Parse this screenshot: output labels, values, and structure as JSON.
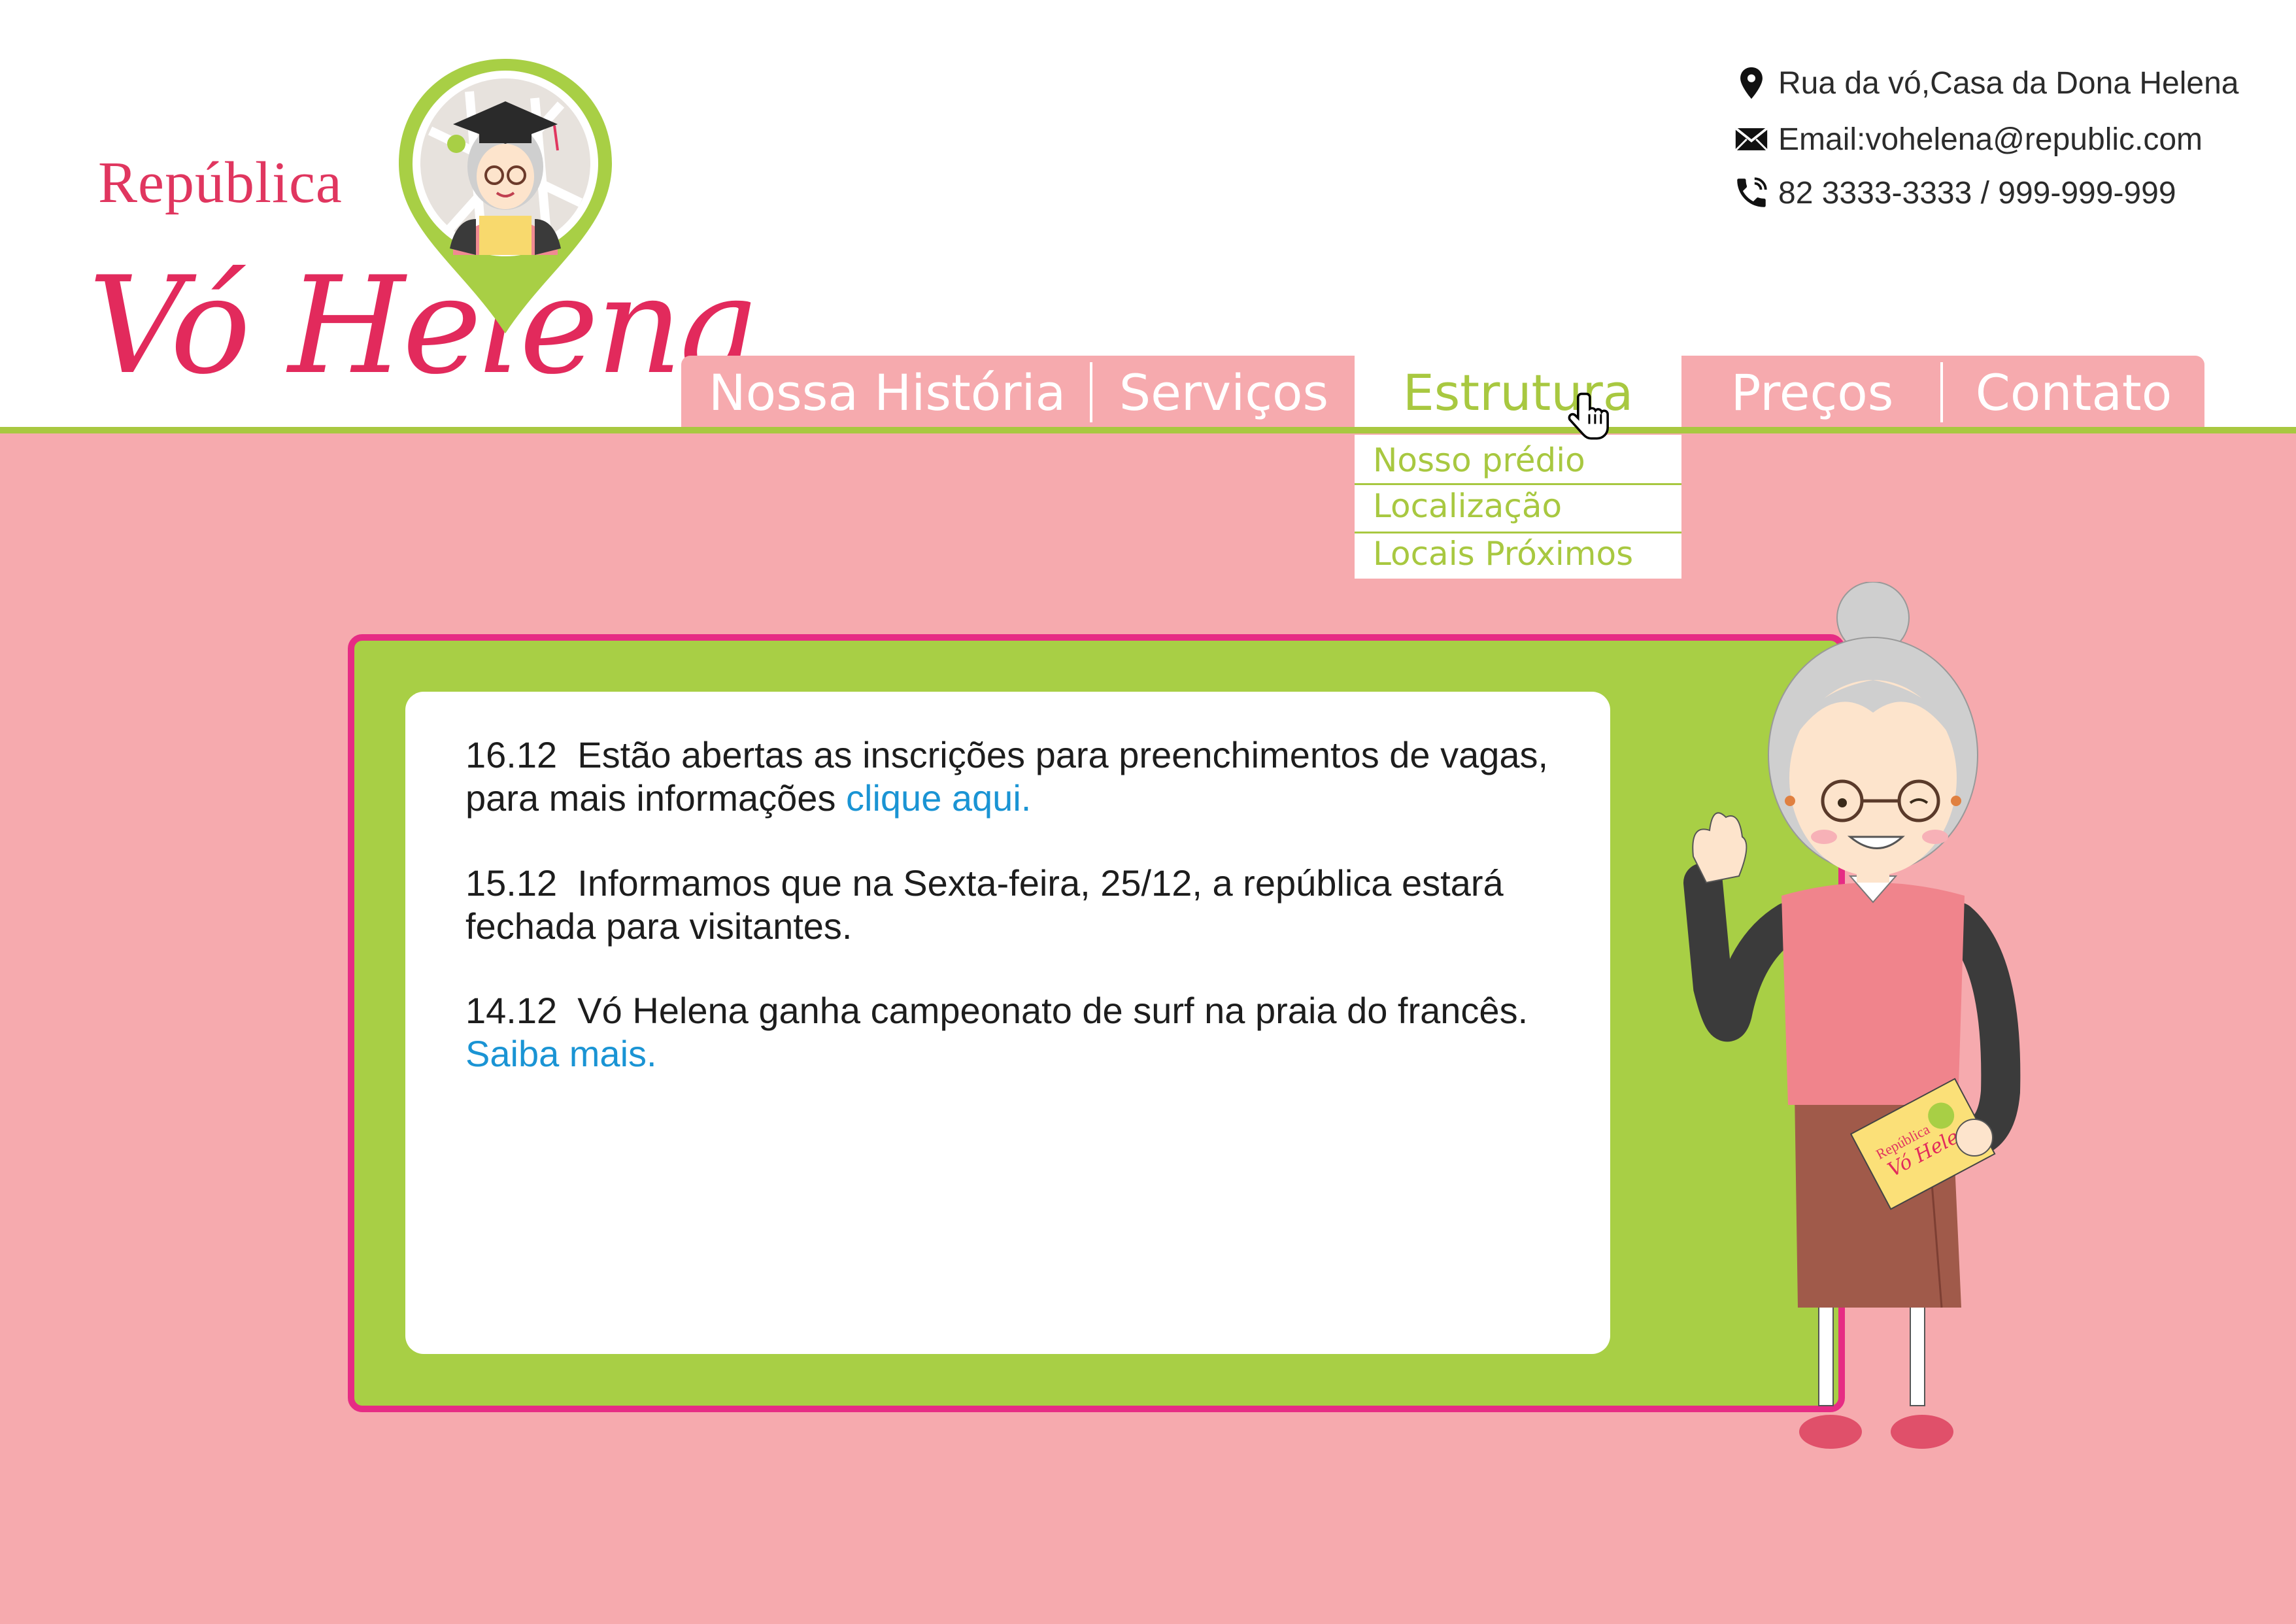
{
  "brand": {
    "line1": "República",
    "line2": "Vó Helena"
  },
  "contact": {
    "address": "Rua da vó,Casa da Dona Helena",
    "email": "Email:vohelena@republic.com",
    "phone": "82 3333-3333 / 999-999-999"
  },
  "nav": {
    "items": [
      {
        "label": "Nossa História"
      },
      {
        "label": "Serviços"
      },
      {
        "label": "Estrutura",
        "active": true
      },
      {
        "label": "Preços"
      },
      {
        "label": "Contato"
      }
    ],
    "dropdown": [
      {
        "label": "Nosso prédio"
      },
      {
        "label": "Localização"
      },
      {
        "label": "Locais Próximos"
      }
    ]
  },
  "news": [
    {
      "date": "16.12",
      "text": "Estão abertas as inscrições para preenchimentos de vagas, para mais informações ",
      "link": "clique aqui."
    },
    {
      "date": "15.12",
      "text": "Informamos que na Sexta-feira, 25/12, a república estará fechada para visitantes.",
      "link": ""
    },
    {
      "date": "14.12",
      "text": "Vó Helena ganha campeonato de surf na praia do francês. ",
      "link": "Saiba mais."
    }
  ],
  "card": {
    "line1": "República",
    "line2": "Vó Hele"
  },
  "colors": {
    "brand_pink": "#e22a5c",
    "nav_pink": "#f6aaae",
    "accent_green": "#a8c840",
    "board_border": "#e62c84",
    "link_blue": "#1a94d4"
  }
}
